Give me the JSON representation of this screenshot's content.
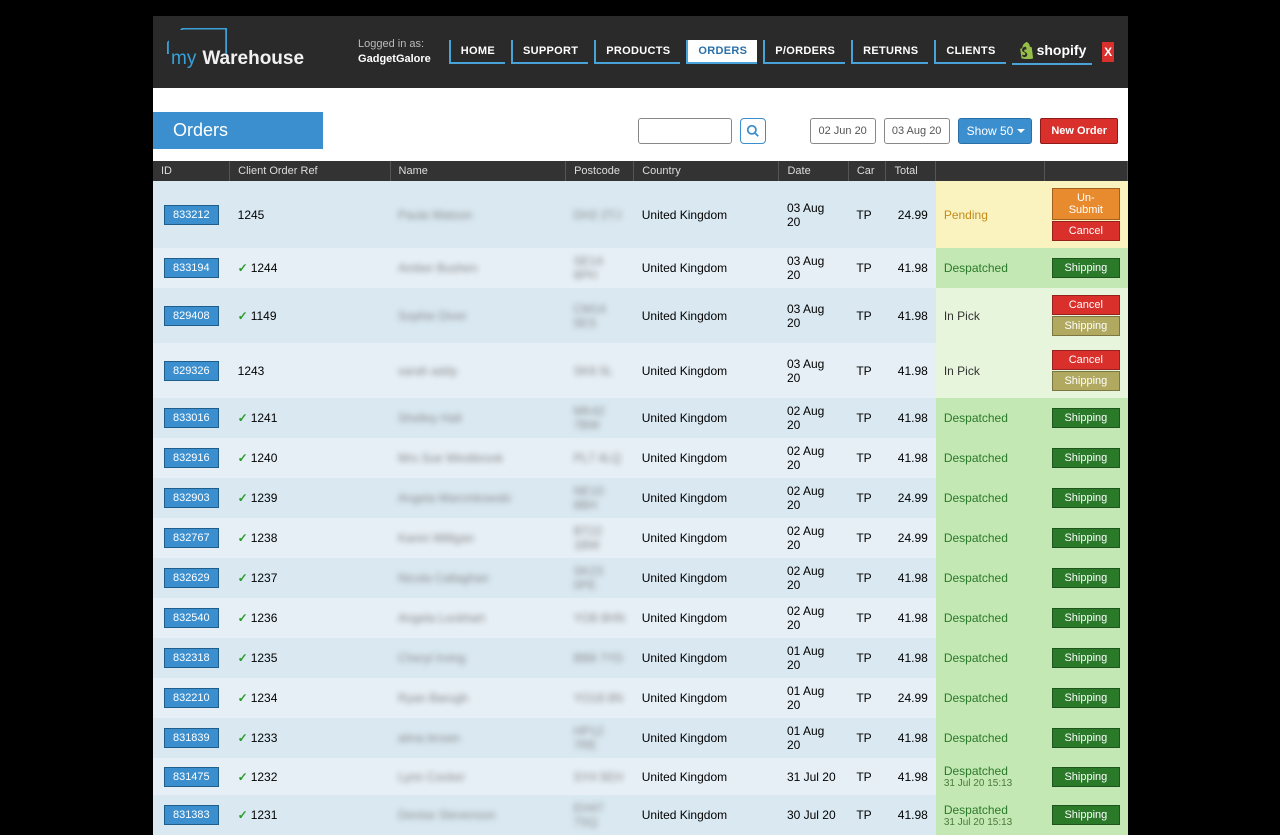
{
  "header": {
    "logo_my": "my",
    "logo_wh": "Warehouse",
    "logged_in_label": "Logged in as:",
    "user": "GadgetGalore",
    "nav": [
      "HOME",
      "SUPPORT",
      "PRODUCTS",
      "ORDERS",
      "P/ORDERS",
      "RETURNS",
      "CLIENTS"
    ],
    "shopify": "shopify",
    "close": "X"
  },
  "toolbar": {
    "tab": "Orders",
    "date_from": "02 Jun 20",
    "date_to": "03 Aug 20",
    "show": "Show 50",
    "new_order": "New Order"
  },
  "columns": [
    "ID",
    "Client Order Ref",
    "Name",
    "Postcode",
    "Country",
    "Date",
    "Car",
    "Total",
    "",
    ""
  ],
  "status_labels": {
    "pending": "Pending",
    "despatched": "Despatched",
    "inpick": "In Pick"
  },
  "action_labels": {
    "unsubmit": "Un-Submit",
    "cancel": "Cancel",
    "shipping": "Shipping"
  },
  "orders": [
    {
      "id": "833212",
      "ref": "1245",
      "chk": false,
      "name": "Paula Watson",
      "pc": "DH2 2TJ",
      "country": "United Kingdom",
      "date": "03 Aug 20",
      "car": "TP",
      "total": "24.99",
      "status": "pending",
      "actions": [
        "unsubmit",
        "cancel"
      ]
    },
    {
      "id": "833194",
      "ref": "1244",
      "chk": true,
      "name": "Amber Bushen",
      "pc": "SE14 6PH",
      "country": "United Kingdom",
      "date": "03 Aug 20",
      "car": "TP",
      "total": "41.98",
      "status": "despatched",
      "actions": [
        "shipping"
      ]
    },
    {
      "id": "829408",
      "ref": "1149",
      "chk": true,
      "name": "Sophie Diver",
      "pc": "CM14 5ES",
      "country": "United Kingdom",
      "date": "03 Aug 20",
      "car": "TP",
      "total": "41.98",
      "status": "inpick",
      "actions": [
        "cancel",
        "shipping-olive"
      ]
    },
    {
      "id": "829326",
      "ref": "1243",
      "chk": false,
      "name": "sarah addy",
      "pc": "SK6 5L",
      "country": "United Kingdom",
      "date": "03 Aug 20",
      "car": "TP",
      "total": "41.98",
      "status": "inpick",
      "actions": [
        "cancel",
        "shipping-olive"
      ]
    },
    {
      "id": "833016",
      "ref": "1241",
      "chk": true,
      "name": "Shelley Hall",
      "pc": "MK42 7BW",
      "country": "United Kingdom",
      "date": "02 Aug 20",
      "car": "TP",
      "total": "41.98",
      "status": "despatched",
      "actions": [
        "shipping"
      ]
    },
    {
      "id": "832916",
      "ref": "1240",
      "chk": true,
      "name": "Mrs Sue Westbrook",
      "pc": "PL7 4LQ",
      "country": "United Kingdom",
      "date": "02 Aug 20",
      "car": "TP",
      "total": "41.98",
      "status": "despatched",
      "actions": [
        "shipping"
      ]
    },
    {
      "id": "832903",
      "ref": "1239",
      "chk": true,
      "name": "Angela Marcinkowski",
      "pc": "NE10 8BH",
      "country": "United Kingdom",
      "date": "02 Aug 20",
      "car": "TP",
      "total": "24.99",
      "status": "despatched",
      "actions": [
        "shipping"
      ]
    },
    {
      "id": "832767",
      "ref": "1238",
      "chk": true,
      "name": "Karen Milligan",
      "pc": "BT22 1BW",
      "country": "United Kingdom",
      "date": "02 Aug 20",
      "car": "TP",
      "total": "24.99",
      "status": "despatched",
      "actions": [
        "shipping"
      ]
    },
    {
      "id": "832629",
      "ref": "1237",
      "chk": true,
      "name": "Nicola Callaghan",
      "pc": "SK23 0PE",
      "country": "United Kingdom",
      "date": "02 Aug 20",
      "car": "TP",
      "total": "41.98",
      "status": "despatched",
      "actions": [
        "shipping"
      ]
    },
    {
      "id": "832540",
      "ref": "1236",
      "chk": true,
      "name": "Angela Lockhart",
      "pc": "YO8 8HN",
      "country": "United Kingdom",
      "date": "02 Aug 20",
      "car": "TP",
      "total": "41.98",
      "status": "despatched",
      "actions": [
        "shipping"
      ]
    },
    {
      "id": "832318",
      "ref": "1235",
      "chk": true,
      "name": "Cheryl Irving",
      "pc": "BB8 7YD",
      "country": "United Kingdom",
      "date": "01 Aug 20",
      "car": "TP",
      "total": "41.98",
      "status": "despatched",
      "actions": [
        "shipping"
      ]
    },
    {
      "id": "832210",
      "ref": "1234",
      "chk": true,
      "name": "Ryan Barugh",
      "pc": "YO18 8N",
      "country": "United Kingdom",
      "date": "01 Aug 20",
      "car": "TP",
      "total": "24.99",
      "status": "despatched",
      "actions": [
        "shipping"
      ]
    },
    {
      "id": "831839",
      "ref": "1233",
      "chk": true,
      "name": "alma brown",
      "pc": "HP12 7RE",
      "country": "United Kingdom",
      "date": "01 Aug 20",
      "car": "TP",
      "total": "41.98",
      "status": "despatched",
      "actions": [
        "shipping"
      ]
    },
    {
      "id": "831475",
      "ref": "1232",
      "chk": true,
      "name": "Lynn Cocker",
      "pc": "SY4 5EH",
      "country": "United Kingdom",
      "date": "31 Jul 20",
      "car": "TP",
      "total": "41.98",
      "status": "despatched",
      "sub": "31 Jul 20 15:13",
      "actions": [
        "shipping"
      ]
    },
    {
      "id": "831383",
      "ref": "1231",
      "chk": true,
      "name": "Denise Stevenson",
      "pc": "EH47 7SQ",
      "country": "United Kingdom",
      "date": "30 Jul 20",
      "car": "TP",
      "total": "41.98",
      "status": "despatched",
      "sub": "31 Jul 20 15:13",
      "actions": [
        "shipping"
      ]
    }
  ]
}
